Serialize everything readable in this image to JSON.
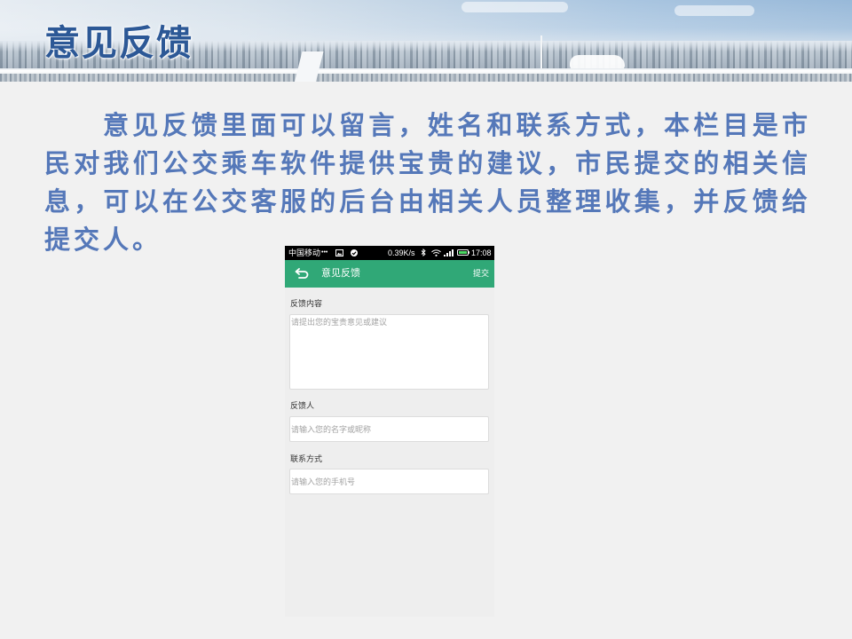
{
  "colors": {
    "title_blue": "#2c5896",
    "body_blue": "#5578b9",
    "app_green": "#30a877",
    "battery_fill": "#4cd964"
  },
  "slide": {
    "title": "意见反馈",
    "body": "意见反馈里面可以留言，姓名和联系方式，本栏目是市民对我们公交乘车软件提供宝贵的建议，市民提交的相关信息，可以在公交客服的后台由相关人员整理收集，并反馈给提交人。"
  },
  "phone": {
    "status_bar": {
      "carrier": "中国移动",
      "dots": "•••",
      "speed": "0.39K/s",
      "time": "17:08",
      "icons": [
        "image-icon",
        "check-circle-icon",
        "bluetooth-icon",
        "wifi-icon",
        "signal-icon",
        "battery-icon"
      ]
    },
    "app_bar": {
      "back_icon": "back-arrow-icon",
      "title": "意见反馈",
      "submit_label": "提交"
    },
    "form": {
      "content": {
        "label": "反馈内容",
        "placeholder": "请提出您的宝贵意见或建议"
      },
      "name": {
        "label": "反馈人",
        "placeholder": "请输入您的名字或昵称"
      },
      "contact": {
        "label": "联系方式",
        "placeholder": "请输入您的手机号"
      }
    }
  }
}
